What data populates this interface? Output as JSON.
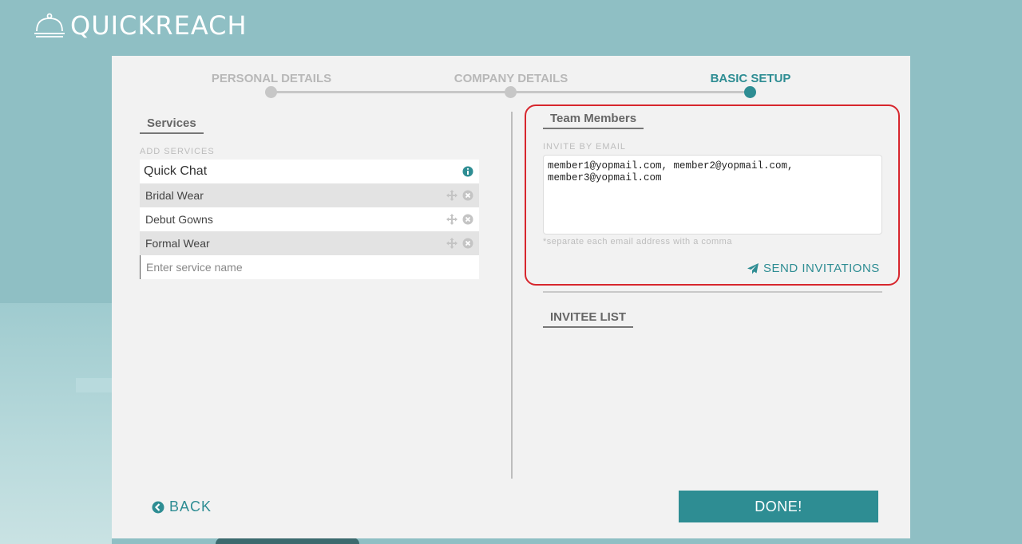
{
  "app": {
    "logo_text": "QUICKREACH"
  },
  "steps": [
    {
      "label": "PERSONAL DETAILS",
      "active": false
    },
    {
      "label": "COMPANY DETAILS",
      "active": false
    },
    {
      "label": "BASIC SETUP",
      "active": true
    }
  ],
  "services": {
    "title": "Services",
    "add_label": "ADD SERVICES",
    "header_item": "Quick Chat",
    "items": [
      "Bridal Wear",
      "Debut Gowns",
      "Formal Wear"
    ],
    "input_placeholder": "Enter service name"
  },
  "team": {
    "title": "Team Members",
    "invite_label": "INVITE BY EMAIL",
    "emails_value": "member1@yopmail.com, member2@yopmail.com, member3@yopmail.com",
    "hint": "*separate each email address with a comma",
    "send_label": "SEND INVITATIONS"
  },
  "invitee": {
    "title": "INVITEE LIST"
  },
  "footer": {
    "back_label": "BACK",
    "done_label": "DONE!"
  },
  "colors": {
    "accent": "#2e8d93",
    "highlight": "#d7262d",
    "background": "#8fbfc4"
  }
}
